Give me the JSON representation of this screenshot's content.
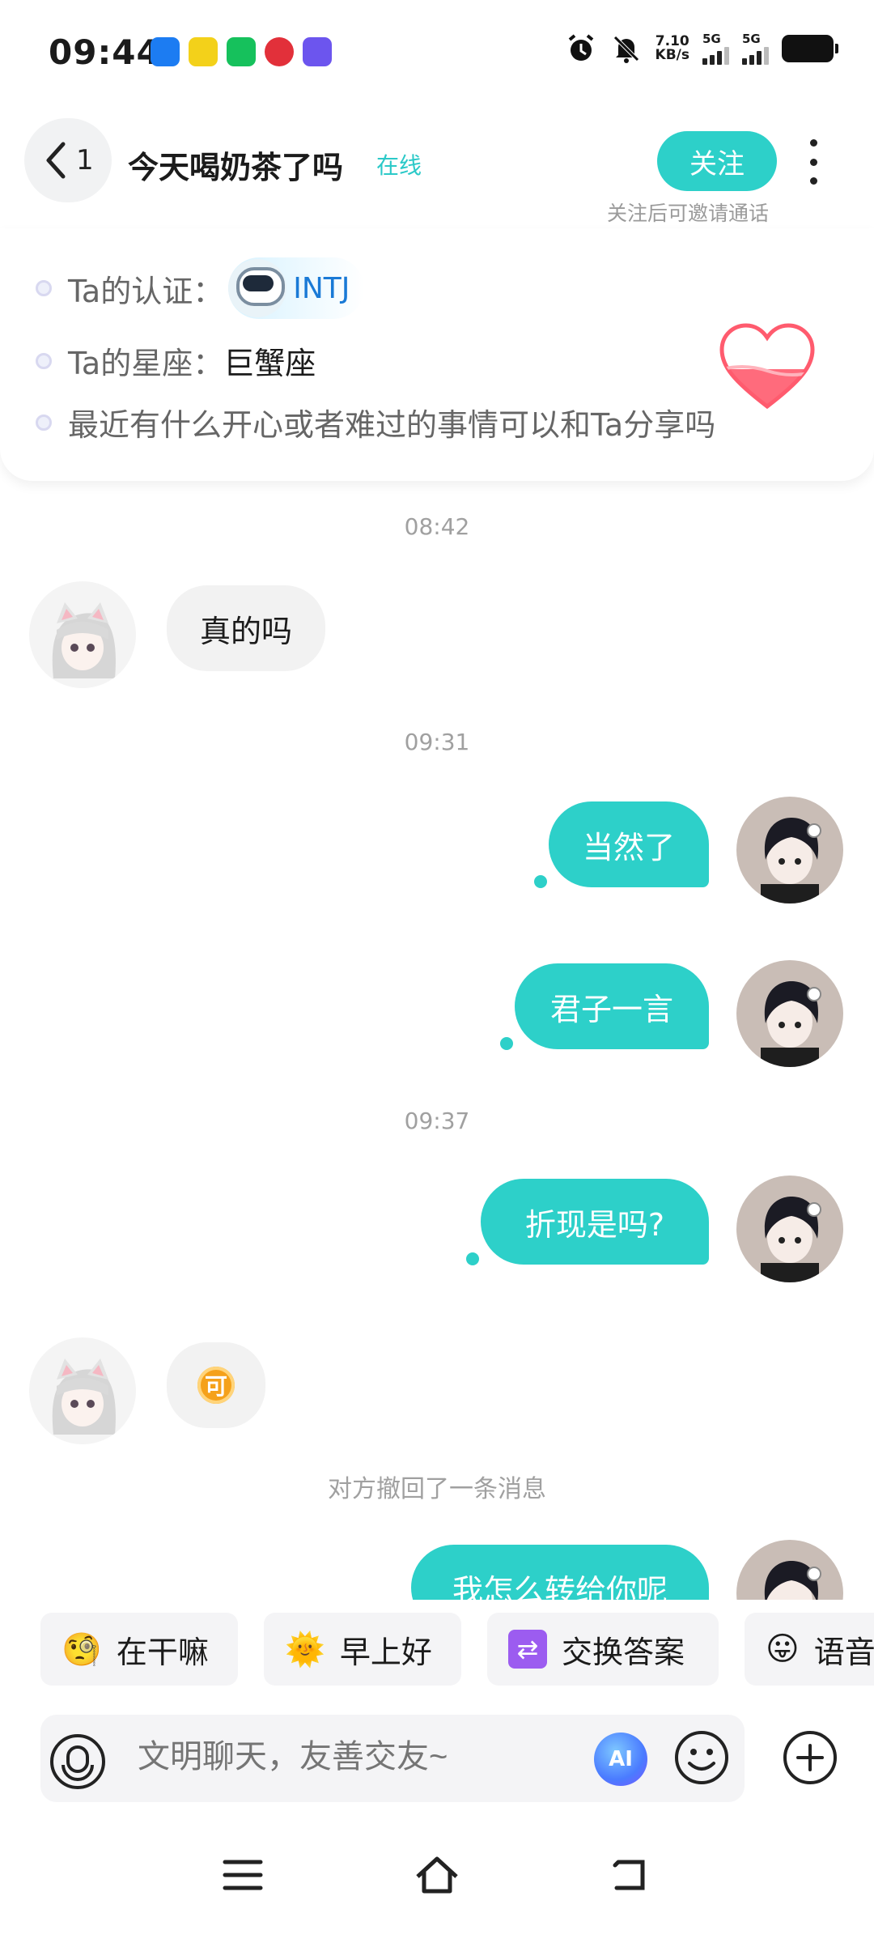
{
  "status_bar": {
    "time": "09:44",
    "net_speed_value": "7.10",
    "net_speed_unit": "KB/s",
    "signal1_label": "5G",
    "signal2_label": "5G",
    "icons": [
      "alarm-icon",
      "mute-icon",
      "battery-icon"
    ]
  },
  "header": {
    "back_count": "1",
    "title": "今天喝奶茶了吗",
    "online": "在线",
    "follow_label": "关注",
    "follow_hint": "关注后可邀请通话"
  },
  "profile_card": {
    "cert_label": "Ta的认证：",
    "cert_value": "INTJ",
    "zodiac_label": "Ta的星座：",
    "zodiac_value": "巨蟹座",
    "prompt": "最近有什么开心或者难过的事情可以和Ta分享吗"
  },
  "messages": {
    "ts1": "08:42",
    "m1": "真的吗",
    "ts2": "09:31",
    "m2": "当然了",
    "m3": "君子一言",
    "ts3": "09:37",
    "m4": "折现是吗?",
    "coin_text": "可",
    "recall": "对方撤回了一条消息",
    "m5": "我怎么转给你呢"
  },
  "quick_replies": [
    {
      "label": "在干嘛",
      "icon": "🧐"
    },
    {
      "label": "早上好",
      "icon": "🌞"
    },
    {
      "label": "交换答案",
      "icon": "⇄"
    },
    {
      "label": "语音",
      "icon": "😛"
    }
  ],
  "input": {
    "placeholder": "文明聊天，友善交友~",
    "ai_label": "AI"
  }
}
